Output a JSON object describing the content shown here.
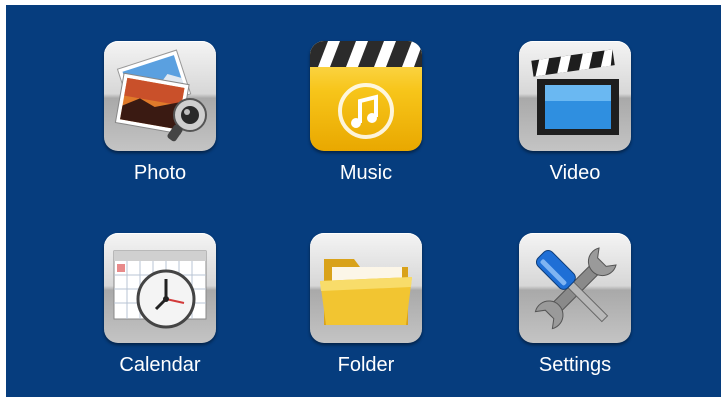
{
  "menu": {
    "items": [
      {
        "label": "Photo",
        "icon": "photo-icon"
      },
      {
        "label": "Music",
        "icon": "music-icon"
      },
      {
        "label": "Video",
        "icon": "video-icon"
      },
      {
        "label": "Calendar",
        "icon": "calendar-icon"
      },
      {
        "label": "Folder",
        "icon": "folder-icon"
      },
      {
        "label": "Settings",
        "icon": "settings-icon"
      }
    ]
  },
  "colors": {
    "background": "#063d7e",
    "label": "#ffffff",
    "tile": "#d7d7d7",
    "music_accent": "#f7c51a",
    "folder_accent": "#f2c531"
  }
}
